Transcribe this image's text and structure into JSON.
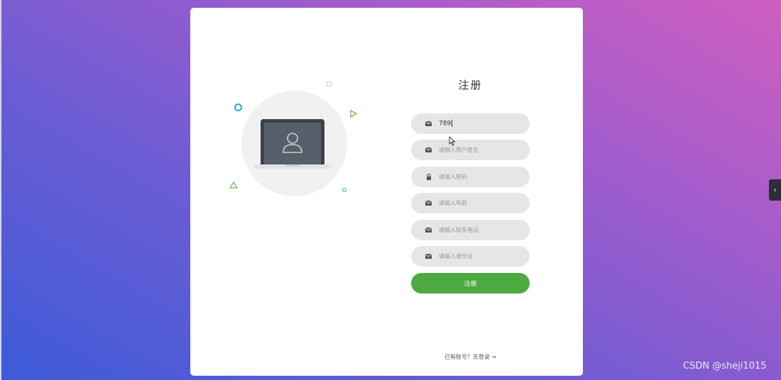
{
  "form": {
    "title": "注册",
    "fields": [
      {
        "icon": "envelope-icon",
        "value": "789",
        "placeholder": ""
      },
      {
        "icon": "envelope-icon",
        "value": "",
        "placeholder": "请输入用户姓名"
      },
      {
        "icon": "lock-icon",
        "value": "",
        "placeholder": "请输入密码"
      },
      {
        "icon": "envelope-icon",
        "value": "",
        "placeholder": "请输入年龄"
      },
      {
        "icon": "envelope-icon",
        "value": "",
        "placeholder": "请输入联系电话"
      },
      {
        "icon": "envelope-icon",
        "value": "",
        "placeholder": "请输入身份证"
      }
    ],
    "submit_label": "注册",
    "login_link": "已有账号？去登录 ➞"
  },
  "side_tab": {
    "label": "‹"
  },
  "watermark": "CSDN @sheji1015",
  "colors": {
    "primary_button": "#4caa40",
    "field_background": "#e6e6e6",
    "background_gradient": [
      "#3d5bd8",
      "#cf5fc0"
    ]
  }
}
